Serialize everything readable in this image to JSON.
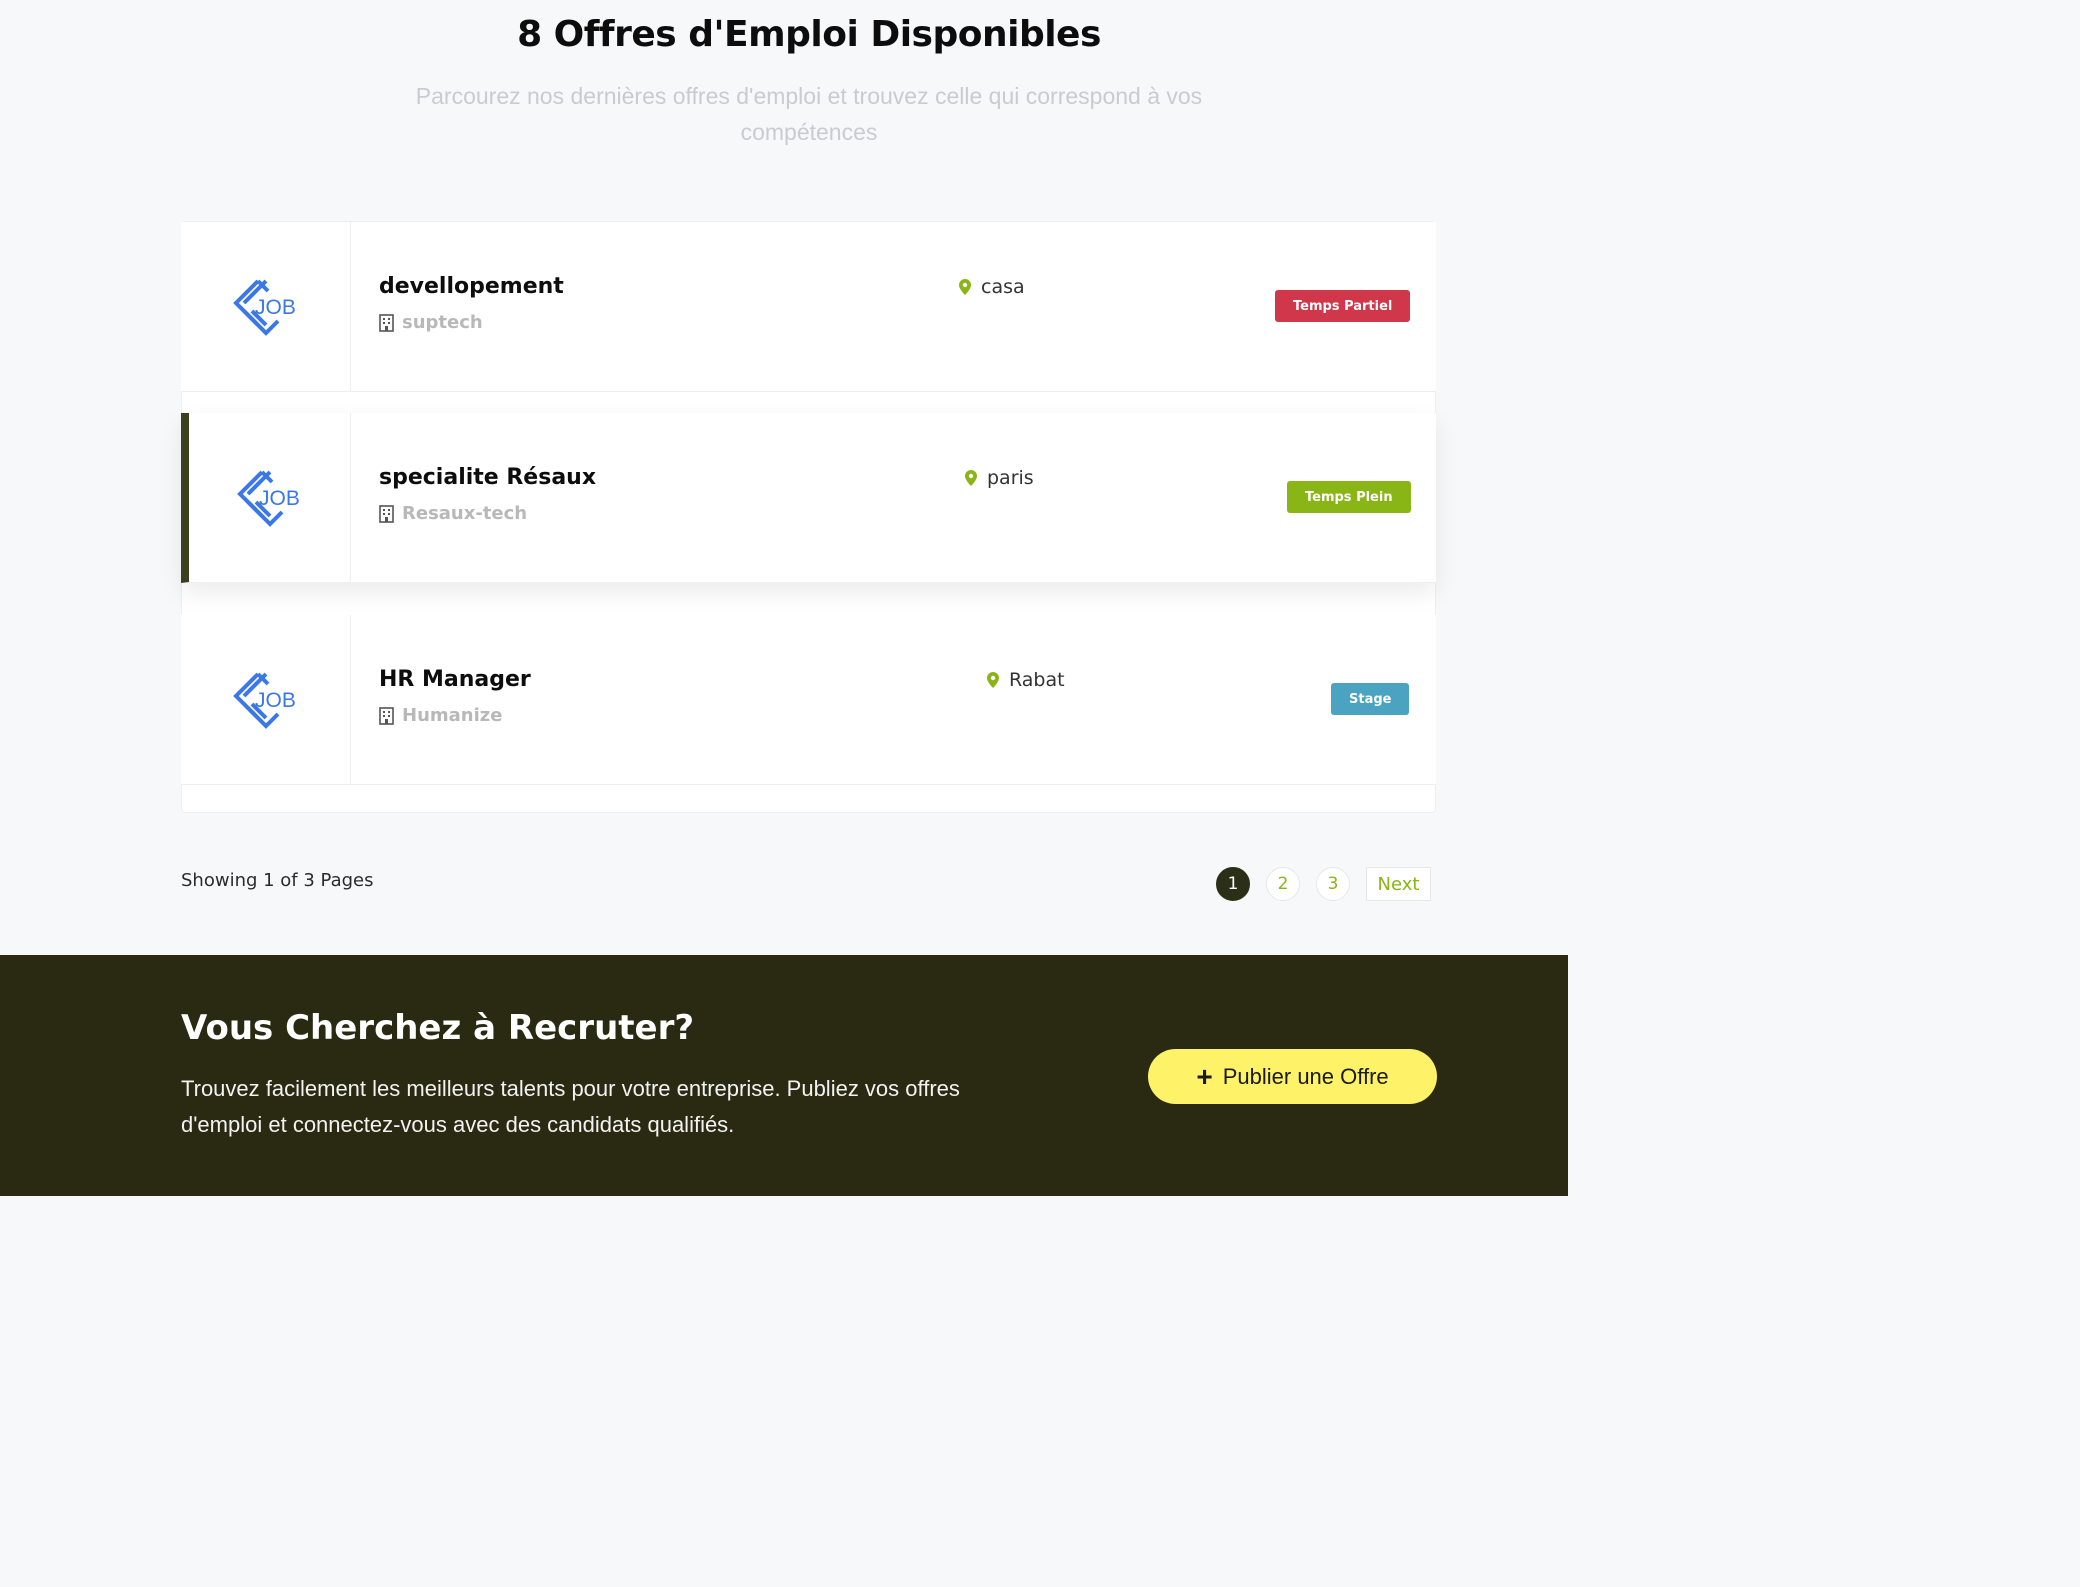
{
  "header": {
    "title": "8 Offres d'Emploi Disponibles",
    "subtitle": "Parcourez nos dernières offres d'emploi et trouvez celle qui correspond à vos compétences"
  },
  "jobs": [
    {
      "logo_text": "JOB",
      "title": "devellopement",
      "company": "suptech",
      "location": "casa",
      "type": "Temps Partiel",
      "type_color": "#d0374a"
    },
    {
      "logo_text": "JOB",
      "title": "specialite Résaux",
      "company": "Resaux-tech",
      "location": "paris",
      "type": "Temps Plein",
      "type_color": "#8ab517"
    },
    {
      "logo_text": "JOB",
      "title": "HR Manager",
      "company": "Humanize",
      "location": "Rabat",
      "type": "Stage",
      "type_color": "#4aa3c0"
    }
  ],
  "pagination": {
    "showing": "Showing 1 of 3 Pages",
    "pages": [
      "1",
      "2",
      "3"
    ],
    "current": "1",
    "next": "Next"
  },
  "cta": {
    "title": "Vous Cherchez à Recruter?",
    "text": "Trouvez facilement les meilleurs talents pour votre entreprise. Publiez vos offres d'emploi et connectez-vous avec des candidats qualifiés.",
    "button_label": "Publier une Offre",
    "button_icon": "plus-icon"
  },
  "colors": {
    "accent_green": "#8ab517",
    "dark_olive": "#2a2a12",
    "cta_yellow": "#fdf268",
    "logo_blue": "#3b78e7"
  }
}
